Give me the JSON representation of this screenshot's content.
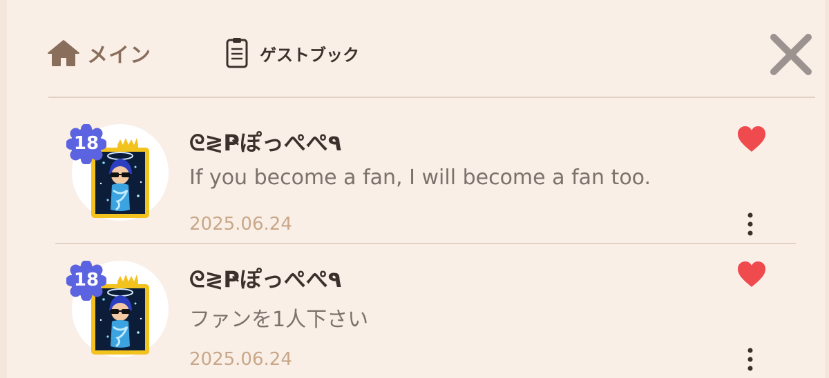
{
  "header": {
    "main_tab_label": "メイン",
    "main_tab_icon": "home-icon",
    "guestbook_tab_label": "ゲストブック",
    "guestbook_tab_icon": "notepad-icon",
    "close_icon": "close-icon"
  },
  "colors": {
    "background": "#f9efe7",
    "divider": "#e3d2c4",
    "main_tab": "#8a6e5c",
    "date": "#c8a788",
    "heart": "#ef4a4e",
    "level_badge": "#5b63e0"
  },
  "entries": [
    {
      "level": "18",
      "author": "ᘓ≷Ҏぽっぺぺ٩",
      "message": "If you become a fan, I will become a fan too.",
      "date": "2025.06.24",
      "liked": true
    },
    {
      "level": "18",
      "author": "ᘓ≷Ҏぽっぺぺ٩",
      "message": "ファンを1人下さい",
      "date": "2025.06.24",
      "liked": true
    }
  ]
}
